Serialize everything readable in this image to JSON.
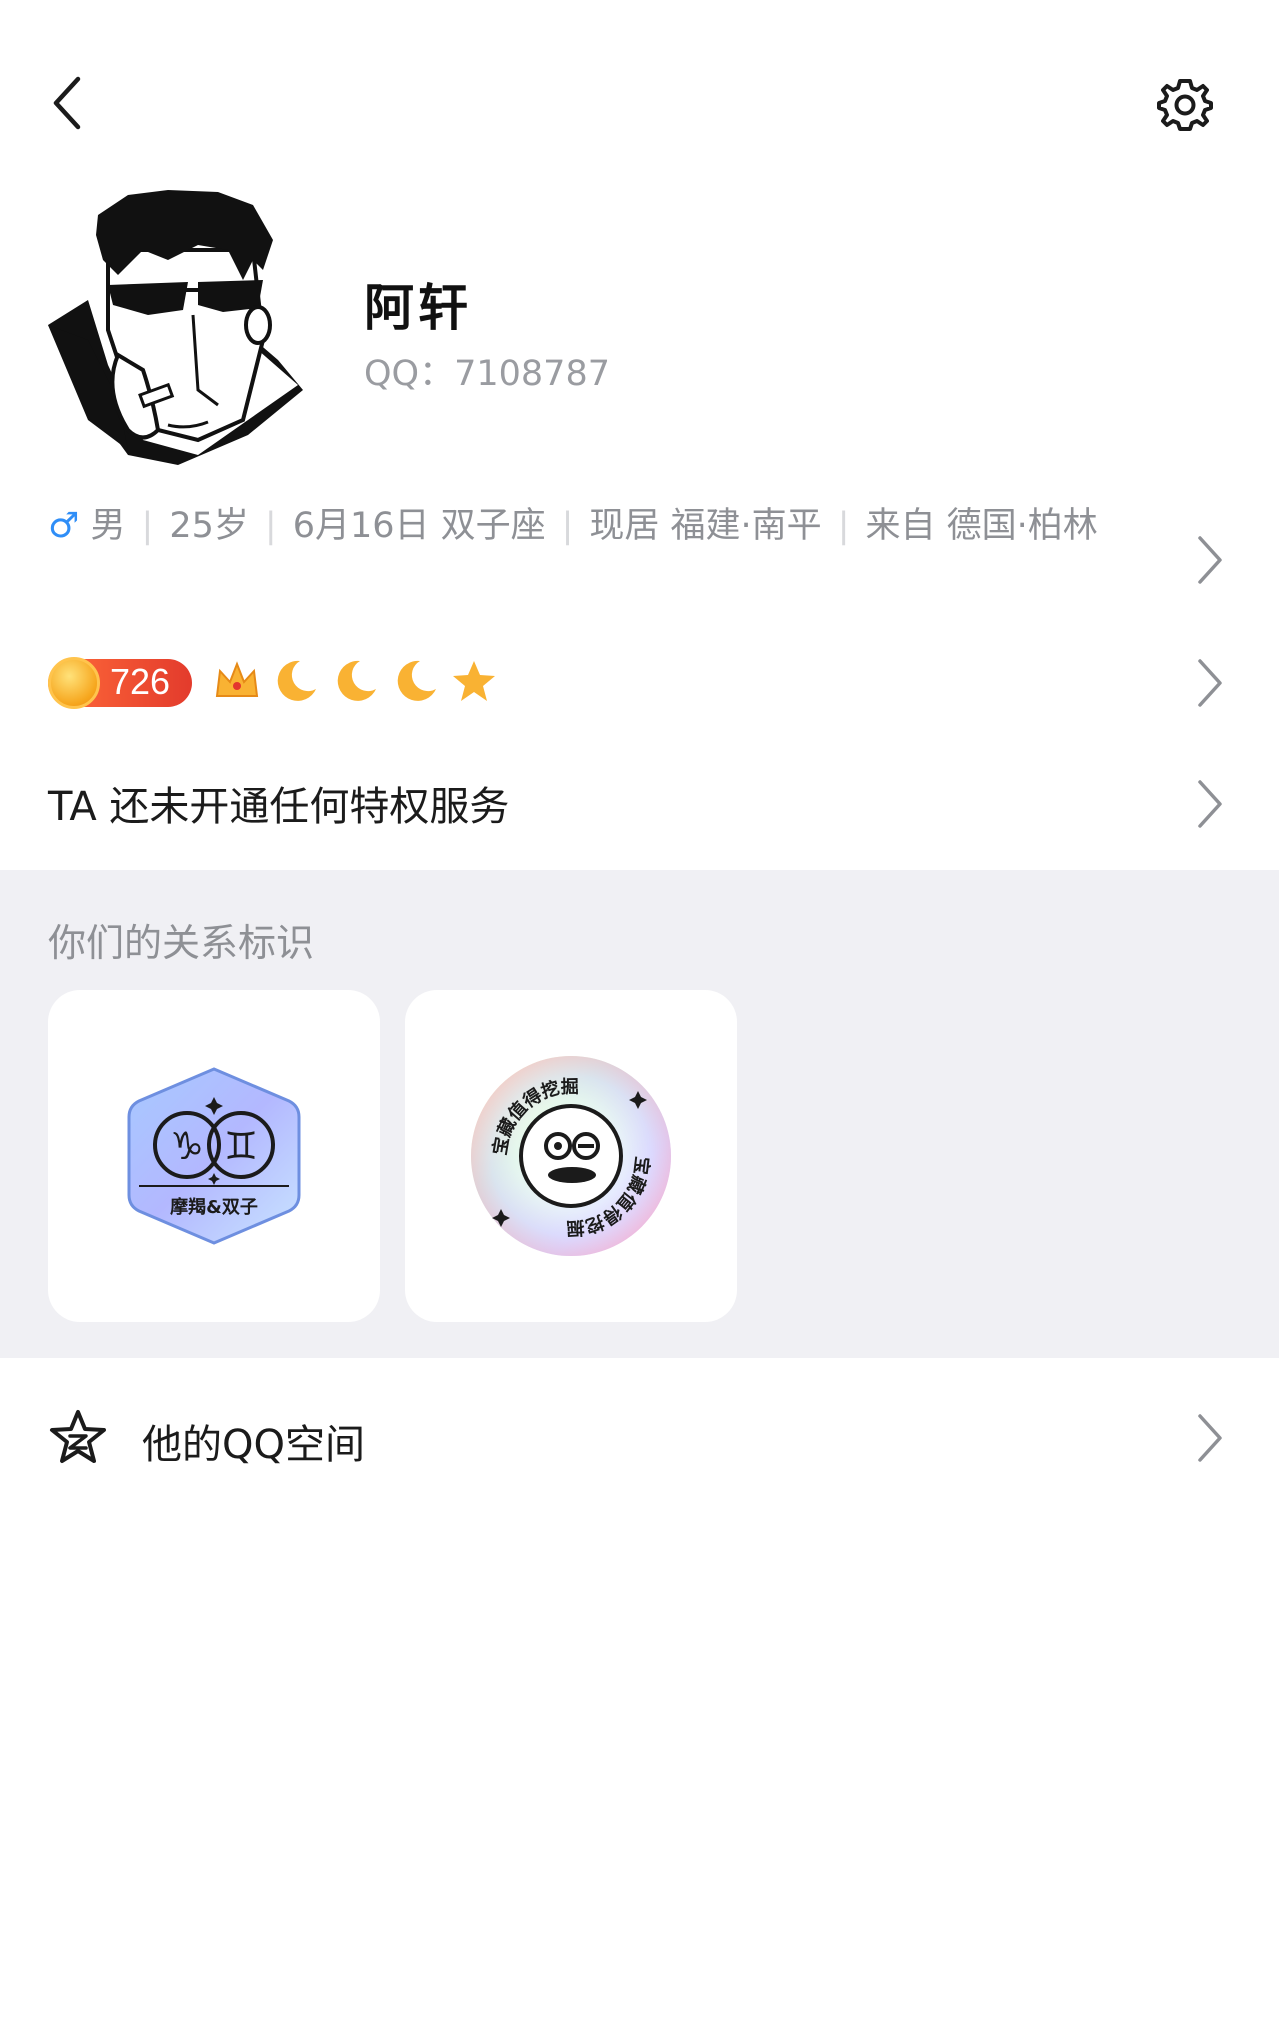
{
  "topbar": {
    "back_icon": "chevron-left-icon",
    "settings_icon": "gear-icon"
  },
  "profile": {
    "nickname": "阿轩",
    "qq_label": "QQ：",
    "qq_number": "7108787"
  },
  "info": {
    "gender_symbol": "♂",
    "gender": "男",
    "age": "25岁",
    "birthday": "6月16日 双子座",
    "residence": "现居 福建·南平",
    "hometown": "来自 德国·柏林",
    "gender_color": "#2f8ef7"
  },
  "level": {
    "value": "726",
    "icons": [
      "crown-icon",
      "moon-icon",
      "moon-icon",
      "moon-icon",
      "star-icon"
    ]
  },
  "privilege": {
    "text": "TA 还未开通任何特权服务"
  },
  "relation": {
    "title": "你们的关系标识",
    "cards": [
      {
        "name": "zodiac-badge",
        "label": "摩羯&双子"
      },
      {
        "name": "treasure-badge",
        "label": "宝藏值得挖掘"
      }
    ]
  },
  "qzone": {
    "label": "他的QQ空间",
    "icon": "qzone-star-icon"
  }
}
